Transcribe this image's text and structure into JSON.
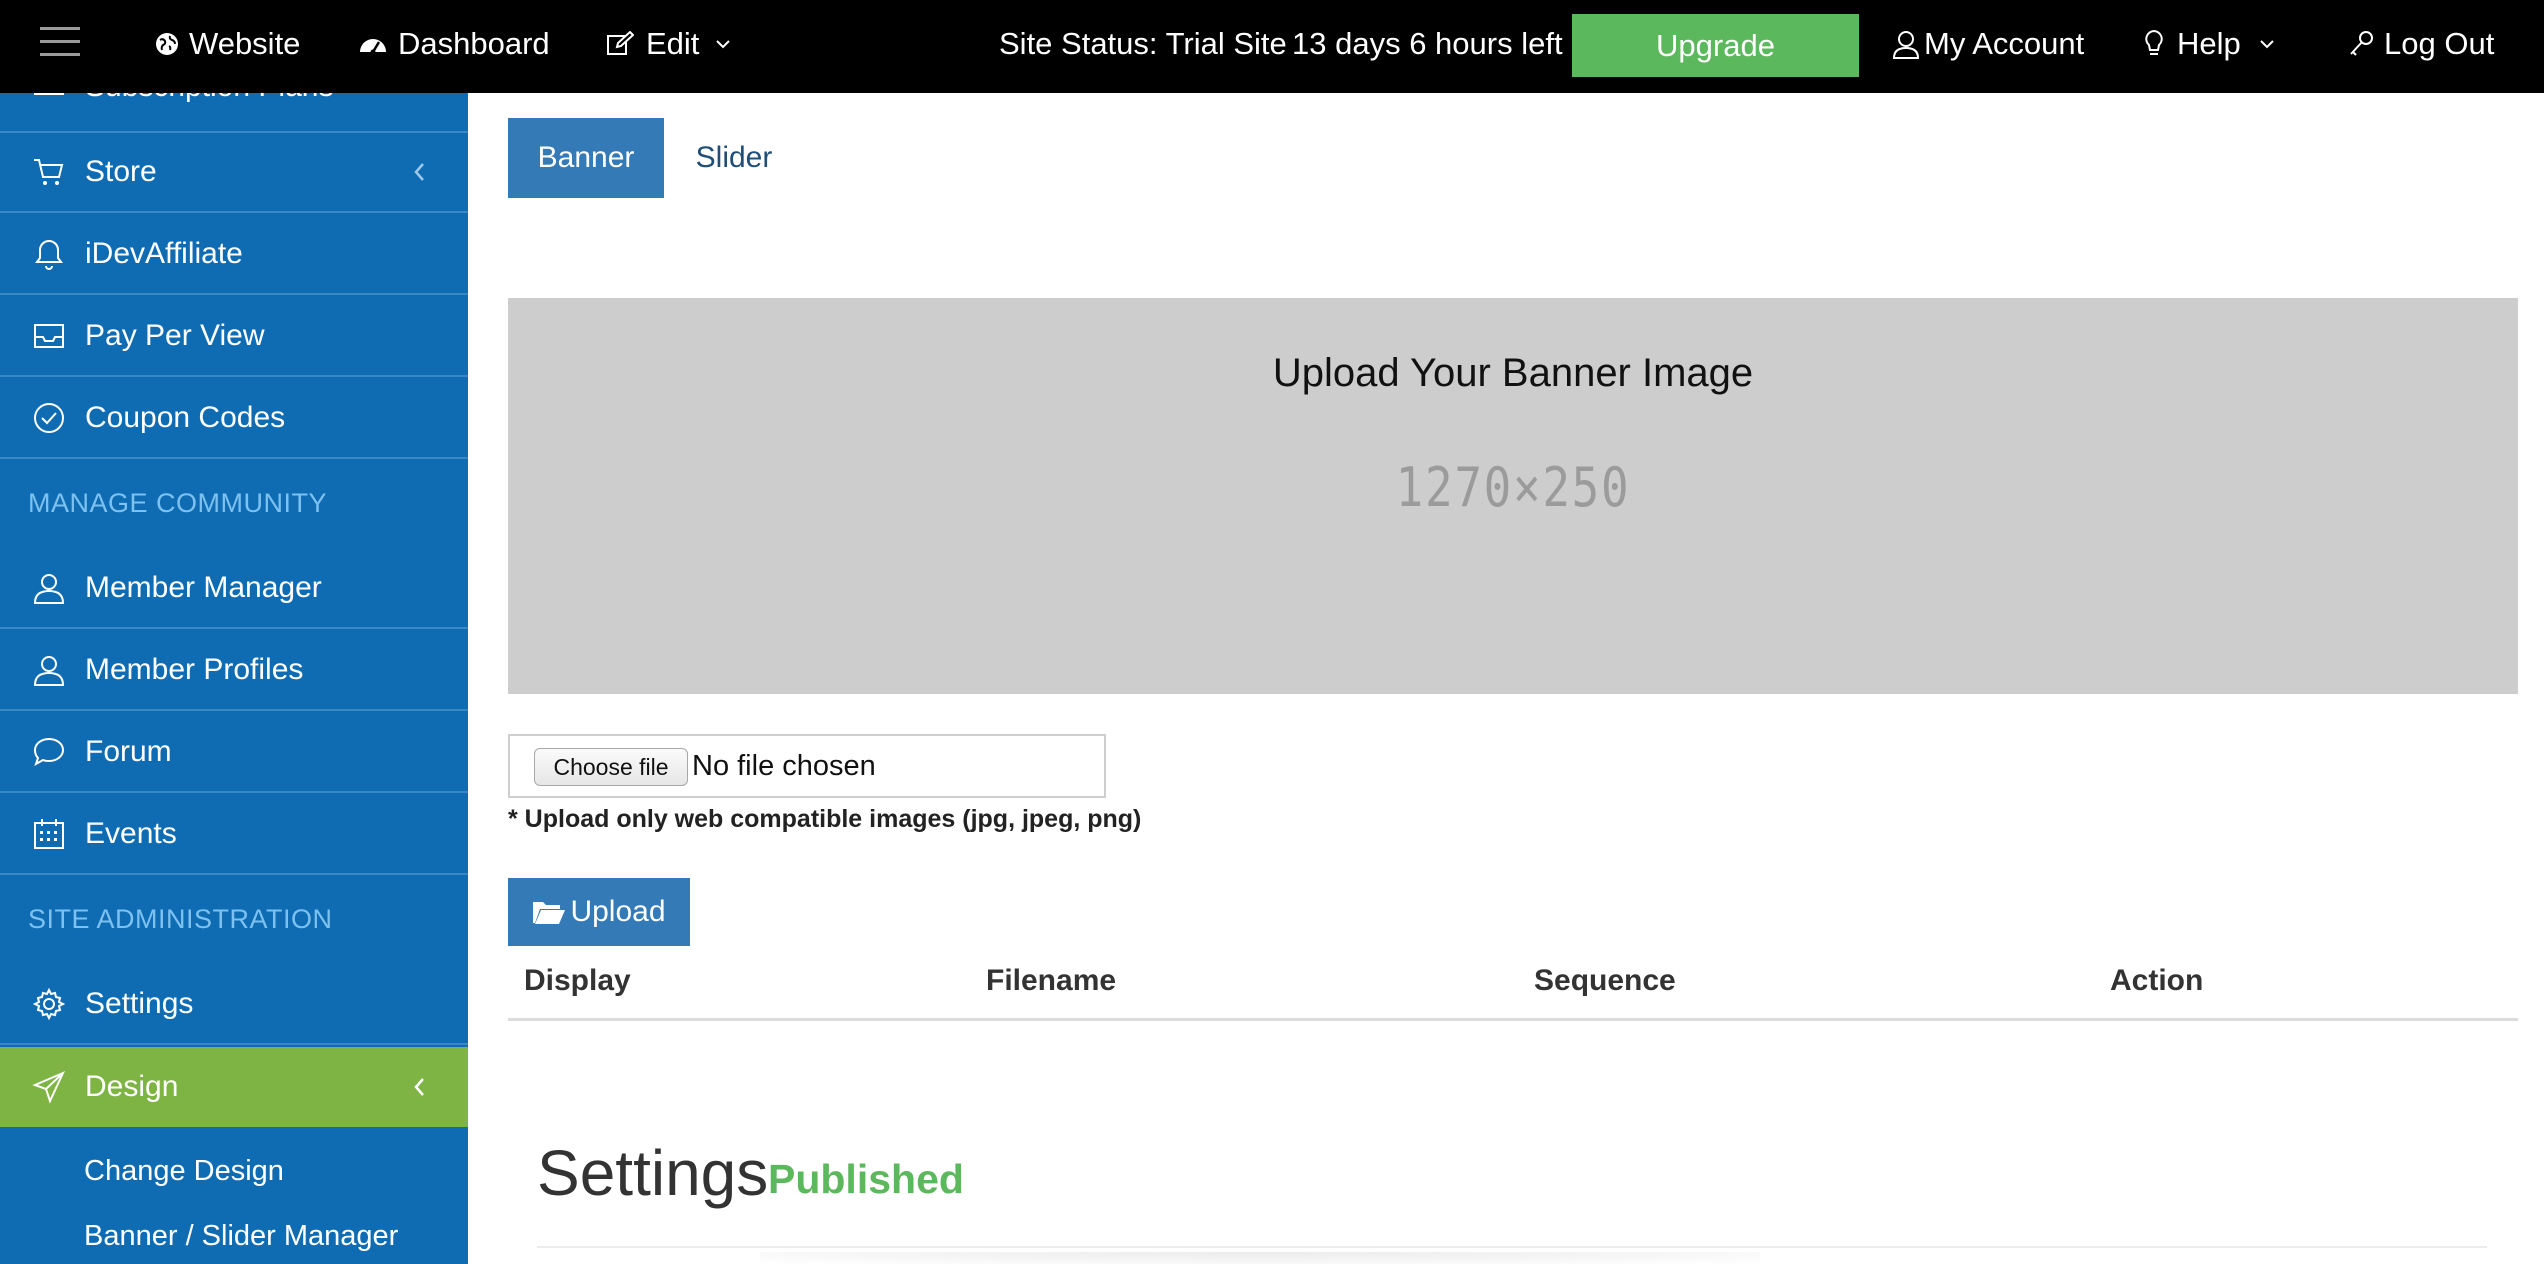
{
  "topbar": {
    "website": "Website",
    "dashboard": "Dashboard",
    "edit": "Edit",
    "site_status": "Site Status: Trial Site",
    "time_left": "13 days 6 hours left -",
    "upgrade": "Upgrade",
    "my_account": "My Account",
    "help": "Help",
    "logout": "Log Out"
  },
  "sidebar": {
    "partial_item": "Subscription Plans",
    "items_store": [
      "Store",
      "iDevAffiliate",
      "Pay Per View",
      "Coupon Codes"
    ],
    "section_community": "MANAGE COMMUNITY",
    "items_community": [
      "Member Manager",
      "Member Profiles",
      "Forum",
      "Events"
    ],
    "section_admin": "SITE ADMINISTRATION",
    "settings": "Settings",
    "design": "Design",
    "sub_items": [
      "Change Design",
      "Banner / Slider Manager"
    ]
  },
  "tabs": [
    "Banner",
    "Slider"
  ],
  "banner": {
    "title": "Upload Your Banner Image",
    "size": "1270×250"
  },
  "file_input": {
    "button": "Choose file",
    "status": "No file chosen"
  },
  "upload_note": "* Upload only web compatible images (jpg, jpeg, png)",
  "upload_button": "Upload",
  "table": {
    "columns": [
      "Display",
      "Filename",
      "Sequence",
      "Action"
    ]
  },
  "settings": {
    "title": "Settings",
    "status": "Published"
  },
  "colors": {
    "sidebar": "#0f6cb3",
    "active": "#7db444",
    "primary": "#337ab7",
    "upgrade": "#5cb85c"
  }
}
